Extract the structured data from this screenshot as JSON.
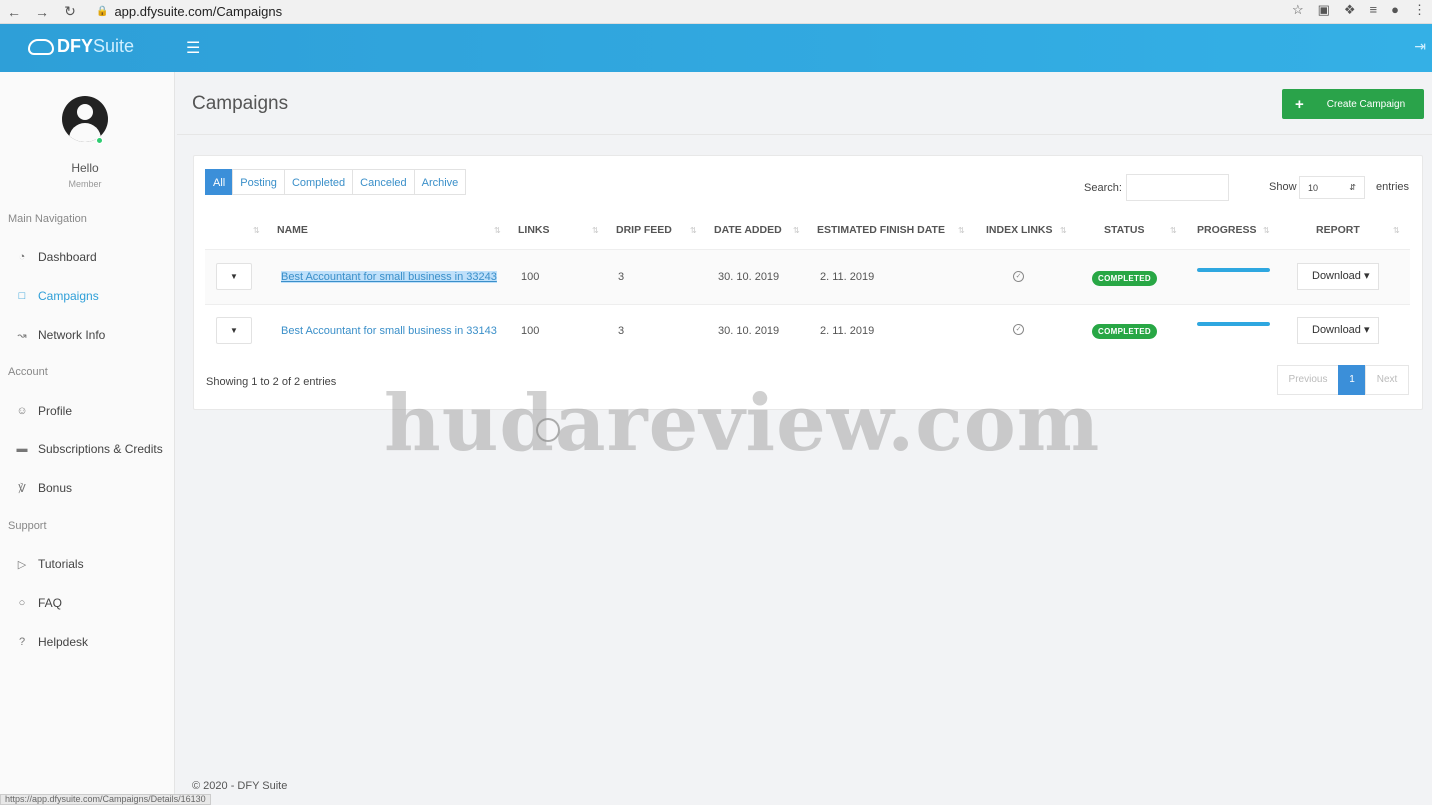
{
  "browser": {
    "url": "app.dfysuite.com/Campaigns",
    "status_url": "https://app.dfysuite.com/Campaigns/Details/16130"
  },
  "header": {
    "logo_part1": "DFY",
    "logo_part2": "Suite"
  },
  "sidebar": {
    "greeting": "Hello",
    "role": "Member",
    "sections": {
      "main": "Main Navigation",
      "account": "Account",
      "support": "Support"
    },
    "items": [
      {
        "label": "Dashboard",
        "icon": "dashboard-icon"
      },
      {
        "label": "Campaigns",
        "icon": "folder-icon",
        "active": true
      },
      {
        "label": "Network Info",
        "icon": "chart-line-icon"
      },
      {
        "label": "Profile",
        "icon": "user-icon"
      },
      {
        "label": "Subscriptions & Credits",
        "icon": "credit-card-icon"
      },
      {
        "label": "Bonus",
        "icon": "trophy-icon"
      },
      {
        "label": "Tutorials",
        "icon": "video-icon"
      },
      {
        "label": "FAQ",
        "icon": "comments-icon"
      },
      {
        "label": "Helpdesk",
        "icon": "question-icon"
      }
    ]
  },
  "main": {
    "title": "Campaigns",
    "create_button": "Create Campaign",
    "tabs": [
      "All",
      "Posting",
      "Completed",
      "Canceled",
      "Archive"
    ],
    "active_tab": "All",
    "search_label": "Search:",
    "search_value": "",
    "show_label": "Show",
    "show_value": "10",
    "entries_label": "entries",
    "columns": [
      "NAME",
      "LINKS",
      "DRIP FEED",
      "DATE ADDED",
      "ESTIMATED FINISH DATE",
      "INDEX LINKS",
      "STATUS",
      "PROGRESS",
      "REPORT"
    ],
    "rows": [
      {
        "name": "Best Accountant for small business in 33243",
        "links": "100",
        "drip_feed": "3",
        "date_added": "30. 10. 2019",
        "finish_date": "2. 11. 2019",
        "status": "COMPLETED",
        "progress": 1.0,
        "report": "Download"
      },
      {
        "name": "Best Accountant for small business in 33143",
        "links": "100",
        "drip_feed": "3",
        "date_added": "30. 10. 2019",
        "finish_date": "2. 11. 2019",
        "status": "COMPLETED",
        "progress": 1.0,
        "report": "Download"
      }
    ],
    "showing_text": "Showing 1 to 2 of 2 entries",
    "pagination": {
      "previous": "Previous",
      "current": "1",
      "next": "Next"
    }
  },
  "footer": "© 2020 - DFY Suite",
  "watermark": "hudareview.com",
  "colors": {
    "header": "#34b0e6",
    "accent": "#3b8fd9",
    "create_button": "#2aa34a",
    "status_completed": "#28a745"
  }
}
